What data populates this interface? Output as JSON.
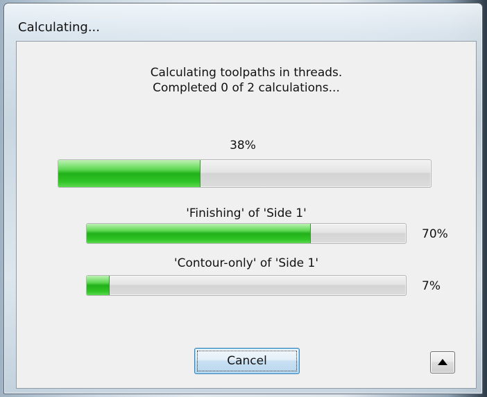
{
  "window": {
    "title": "Calculating..."
  },
  "message": {
    "line1": "Calculating toolpaths in threads.",
    "line2": "Completed 0 of 2 calculations..."
  },
  "overall": {
    "label": "38%",
    "progress": 0.38
  },
  "threads": [
    {
      "label": "'Finishing' of 'Side 1'",
      "percent_text": "70%",
      "progress": 0.7
    },
    {
      "label": "'Contour-only' of 'Side 1'",
      "percent_text": "7%",
      "progress": 0.07
    }
  ],
  "buttons": {
    "cancel_label": "Cancel",
    "toggle_icon": "triangle-up-icon"
  },
  "colors": {
    "progress_green": "#22b11a"
  }
}
